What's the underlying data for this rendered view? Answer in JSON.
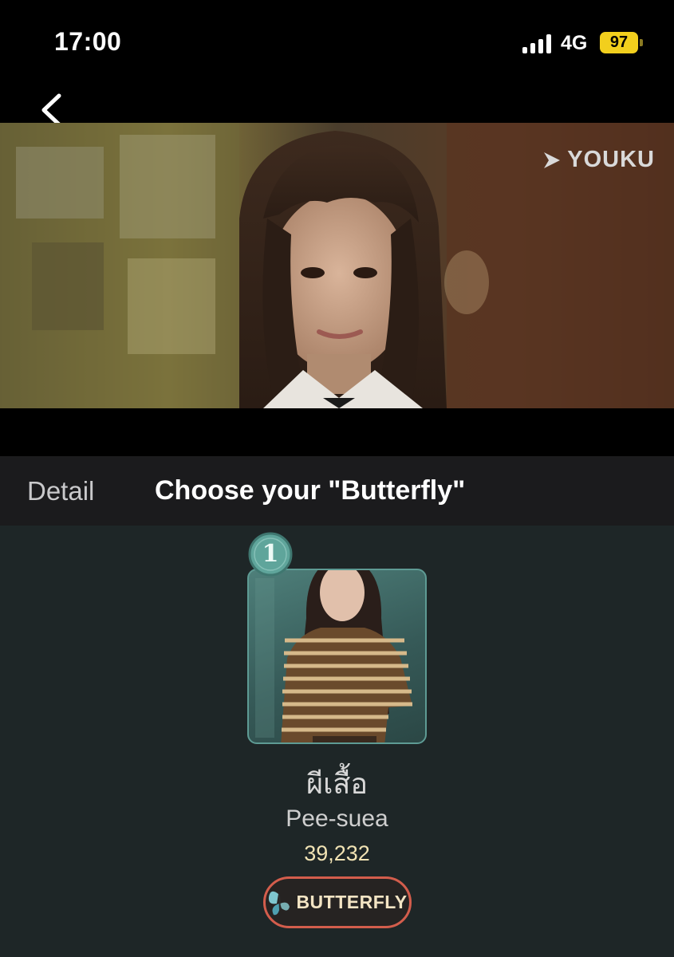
{
  "status_bar": {
    "time": "17:00",
    "network": "4G",
    "battery": "97",
    "icons": [
      "signal-icon",
      "battery-icon"
    ]
  },
  "header": {
    "back_icon": "chevron-left-icon",
    "video": {
      "watermark": "YOUKU"
    }
  },
  "tabs": [
    {
      "label": "Detail",
      "active": false
    },
    {
      "label": "Choose your \"Butterfly\"",
      "active": true
    }
  ],
  "candidate": {
    "rank": "1",
    "name_thai": "ผีเสื้อ",
    "name_english": "Pee-suea",
    "votes": "39,232",
    "vote_button_label": "BUTTERFLY",
    "vote_button_icon": "butterfly-icon"
  },
  "colors": {
    "background": "#000000",
    "tab_bar": "#1b1b1d",
    "content_bg": "#1e2627",
    "card_accent": "#5e9b94",
    "votes_text": "#f1e3b4",
    "button_border": "#d35d4c",
    "battery": "#f2cf1d"
  }
}
